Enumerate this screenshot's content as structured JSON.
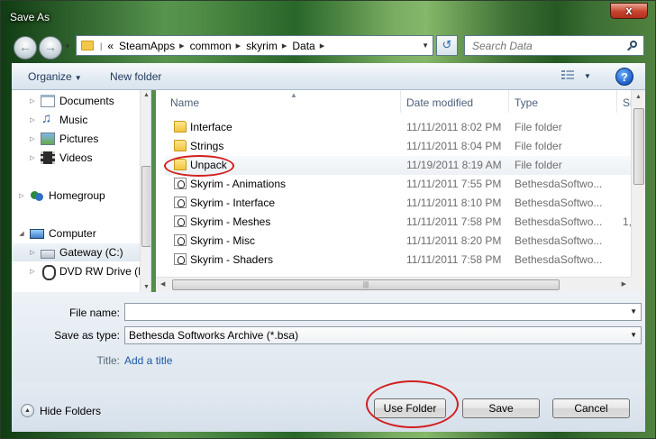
{
  "window": {
    "title": "Save As",
    "close_glyph": "x"
  },
  "address": {
    "overflow": "«",
    "segments": [
      "SteamApps",
      "common",
      "skyrim",
      "Data"
    ],
    "search_placeholder": "Search Data"
  },
  "toolbar": {
    "organize_label": "Organize",
    "new_folder_label": "New folder",
    "help_glyph": "?"
  },
  "navpane": {
    "items": [
      {
        "label": "Documents"
      },
      {
        "label": "Music"
      },
      {
        "label": "Pictures"
      },
      {
        "label": "Videos"
      },
      {
        "label": "Homegroup"
      },
      {
        "label": "Computer"
      },
      {
        "label": "Gateway (C:)"
      },
      {
        "label": "DVD RW Drive (D"
      }
    ]
  },
  "filelist": {
    "columns": [
      "Name",
      "Date modified",
      "Type",
      "Si"
    ],
    "rows": [
      {
        "name": "Interface",
        "date": "11/11/2011 8:02 PM",
        "type": "File folder",
        "size": "",
        "icon": "folder-icon"
      },
      {
        "name": "Strings",
        "date": "11/11/2011 8:04 PM",
        "type": "File folder",
        "size": "",
        "icon": "folder-icon"
      },
      {
        "name": "Unpack",
        "date": "11/19/2011 8:19 AM",
        "type": "File folder",
        "size": "",
        "icon": "folder-icon"
      },
      {
        "name": "Skyrim - Animations",
        "date": "11/11/2011 7:55 PM",
        "type": "BethesdaSoftwo...",
        "size": "",
        "icon": "bsa-file-icon"
      },
      {
        "name": "Skyrim - Interface",
        "date": "11/11/2011 8:10 PM",
        "type": "BethesdaSoftwo...",
        "size": "",
        "icon": "bsa-file-icon"
      },
      {
        "name": "Skyrim - Meshes",
        "date": "11/11/2011 7:58 PM",
        "type": "BethesdaSoftwo...",
        "size": "1,",
        "icon": "bsa-file-icon"
      },
      {
        "name": "Skyrim - Misc",
        "date": "11/11/2011 8:20 PM",
        "type": "BethesdaSoftwo...",
        "size": "",
        "icon": "bsa-file-icon"
      },
      {
        "name": "Skyrim - Shaders",
        "date": "11/11/2011 7:58 PM",
        "type": "BethesdaSoftwo...",
        "size": "",
        "icon": "bsa-file-icon"
      }
    ]
  },
  "form": {
    "file_name_label": "File name:",
    "file_name_value": "",
    "save_as_type_label": "Save as type:",
    "save_as_type_value": "Bethesda Softworks Archive (*.bsa)",
    "title_label": "Title:",
    "title_link": "Add a title"
  },
  "footer": {
    "hide_folders_label": "Hide Folders",
    "use_folder_label": "Use Folder",
    "save_label": "Save",
    "cancel_label": "Cancel"
  },
  "colors": {
    "annotation_red": "#d31f1f",
    "link_blue": "#1c57a5"
  }
}
